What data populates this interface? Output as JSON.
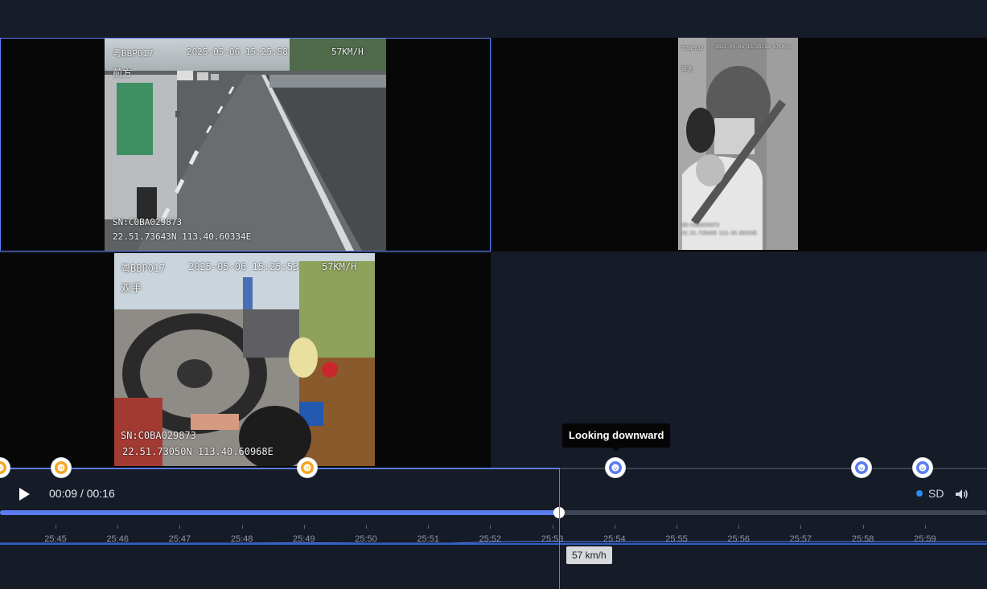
{
  "player": {
    "current_time": "00:09",
    "duration": "00:16",
    "time_display": "00:09 / 00:16",
    "progress": 0.566,
    "quality_label": "SD",
    "play_icon": "play-icon",
    "volume_icon": "volume-icon"
  },
  "channels": [
    {
      "plate": "粤BBP017",
      "datetime": "2025-05-06 15:25:58",
      "speed": "57KM/H",
      "label": "前方",
      "serial": "SN:C0BA029873",
      "gps": "22.51.73643N 113.40.60334E"
    },
    {
      "plate": "粤BBP017",
      "datetime": "2025-05-06 15:25:58",
      "speed": "57KM/H",
      "label": "驾驶",
      "serial": "SN:C0BA029873",
      "gps": "22.51.73643N 113.40.60334E"
    },
    {
      "plate": "粤BBP017",
      "datetime": "2025-05-06 15:25:53",
      "speed": "57KM/H",
      "label": "双手",
      "serial": "SN:C0BA029873",
      "gps": "22.51.73050N 113.40.60968E"
    }
  ],
  "events": {
    "tooltip": "Looking downward",
    "markers": [
      {
        "type": "orange",
        "icon": "alert-face-icon"
      },
      {
        "type": "orange",
        "icon": "alert-face-icon"
      },
      {
        "type": "orange",
        "icon": "alert-face-icon"
      },
      {
        "type": "blue",
        "icon": "looking-down-icon"
      },
      {
        "type": "blue",
        "icon": "looking-down-icon"
      },
      {
        "type": "blue",
        "icon": "looking-down-icon"
      }
    ]
  },
  "timeline": {
    "ticks": [
      "25:45",
      "25:46",
      "25:47",
      "25:48",
      "25:49",
      "25:50",
      "25:51",
      "25:52",
      "25:53",
      "25:54",
      "25:55",
      "25:56",
      "25:57",
      "25:58",
      "25:59"
    ],
    "speed_readout": "57 km/h"
  },
  "colors": {
    "accent": "#5b7cf0",
    "event_orange": "#f5a623",
    "cursor_green": "#3cb043",
    "quality_dot": "#2d8cf0"
  }
}
